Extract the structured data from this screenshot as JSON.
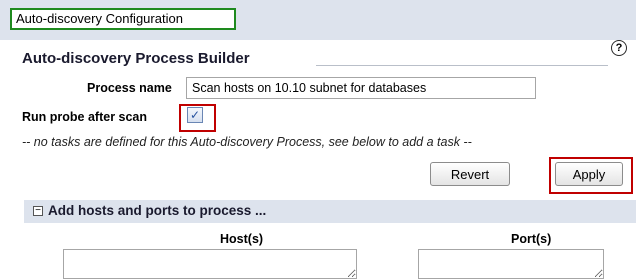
{
  "header": {
    "breadcrumb": "Auto-discovery Configuration"
  },
  "builder": {
    "title": "Auto-discovery Process Builder",
    "help_icon": "?",
    "process_name_label": "Process name",
    "process_name_value": "Scan hosts on 10.10 subnet for databases",
    "run_probe_label": "Run probe after scan",
    "run_probe_checked": true,
    "checkbox_glyph": "✓",
    "notice": "-- no tasks are defined for this Auto-discovery Process, see below to add a task --"
  },
  "buttons": {
    "revert": "Revert",
    "apply": "Apply"
  },
  "section": {
    "expander_glyph": "−",
    "title": "Add hosts and ports to process ...",
    "hosts_header": "Host(s)",
    "ports_header": "Port(s)"
  },
  "colors": {
    "highlight_green": "#1e8a1e",
    "highlight_red": "#c00000",
    "band_background": "#dde3ed"
  }
}
